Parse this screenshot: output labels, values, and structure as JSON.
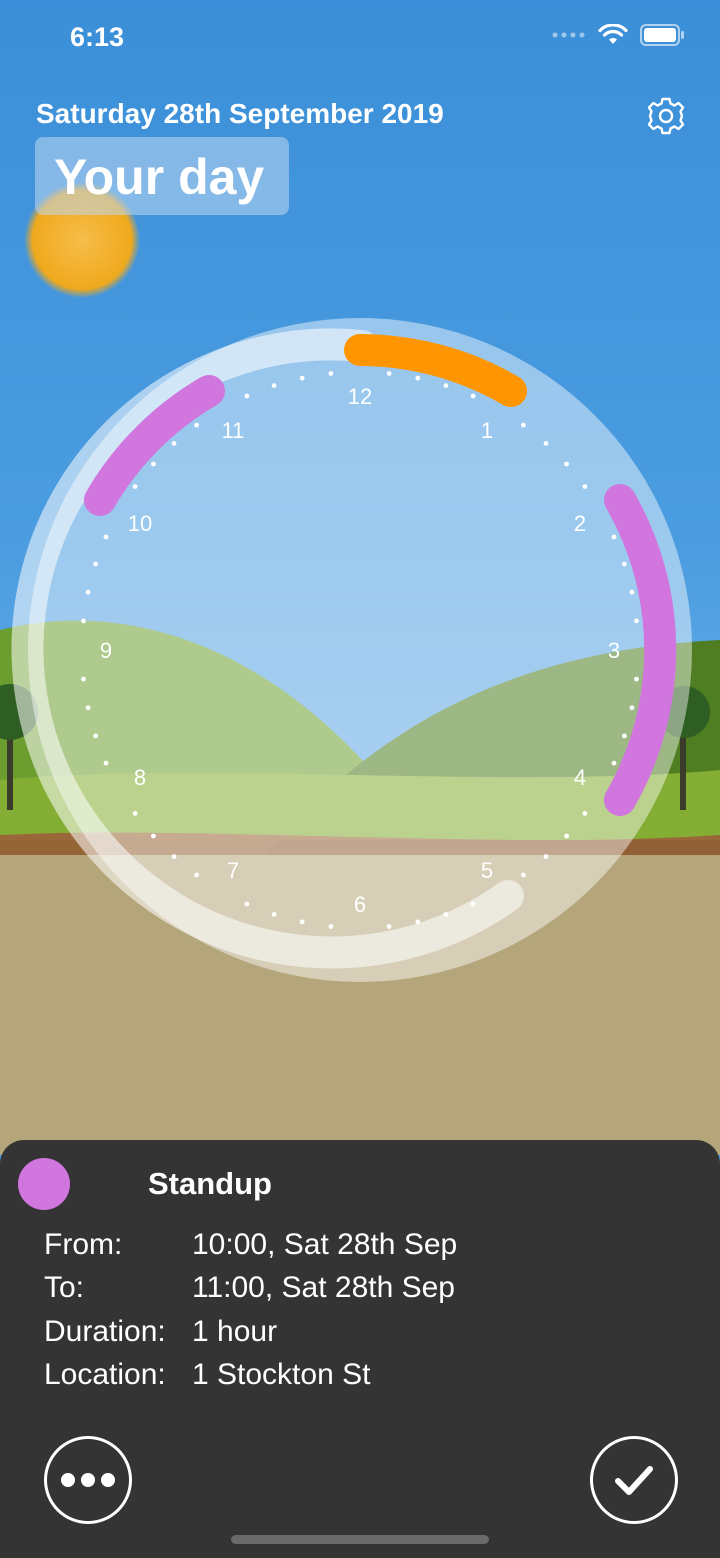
{
  "status_bar": {
    "time": "6:13"
  },
  "header": {
    "date": "Saturday 28th September 2019",
    "title": "Your day"
  },
  "clock": {
    "hour_labels": [
      "12",
      "1",
      "2",
      "3",
      "4",
      "5",
      "6",
      "7",
      "8",
      "9",
      "10",
      "11"
    ],
    "colors": {
      "orange": "#ff9500",
      "purple": "#d076de"
    }
  },
  "event_sheet": {
    "title": "Standup",
    "color": "#d076de",
    "rows": [
      {
        "label": "From:",
        "value": "10:00, Sat 28th Sep"
      },
      {
        "label": "To:",
        "value": "11:00, Sat 28th Sep"
      },
      {
        "label": "Duration:",
        "value": "1 hour"
      },
      {
        "label": "Location:",
        "value": "1 Stockton St"
      }
    ],
    "more_icon": "ellipsis-icon",
    "done_icon": "checkmark-icon"
  }
}
